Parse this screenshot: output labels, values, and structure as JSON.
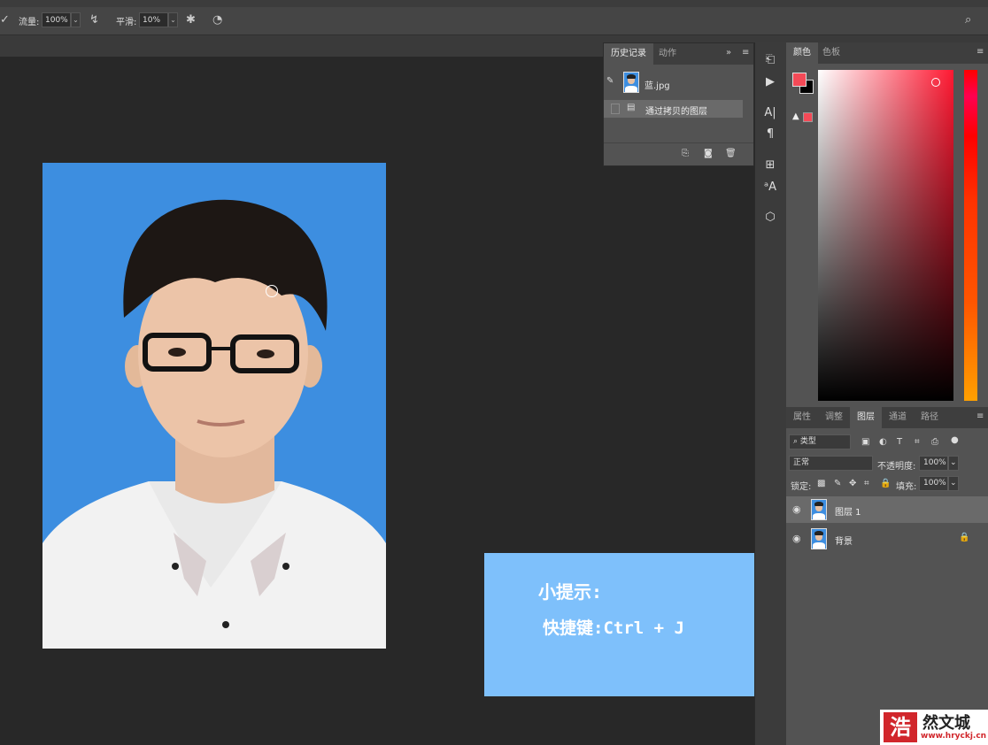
{
  "options_bar": {
    "flow_label": "流量:",
    "flow_value": "100%",
    "smooth_label": "平滑:",
    "smooth_value": "10%"
  },
  "history_panel": {
    "tabs": [
      "历史记录",
      "动作"
    ],
    "snapshot_name": "蓝.jpg",
    "steps": [
      "通过拷贝的图层"
    ]
  },
  "color_panel": {
    "tabs": [
      "颜色",
      "色板"
    ],
    "foreground": "#f44a57",
    "background": "#000000"
  },
  "layers_panel": {
    "tabs": [
      "属性",
      "调整",
      "图层",
      "通道",
      "路径"
    ],
    "filter_kind": "类型",
    "blend_mode": "正常",
    "opacity_label": "不透明度:",
    "opacity_value": "100%",
    "lock_label": "锁定:",
    "fill_label": "填充:",
    "fill_value": "100%",
    "layers": [
      {
        "name": "图层 1",
        "selected": true
      },
      {
        "name": "背景",
        "locked": true
      }
    ]
  },
  "tip": {
    "title": "小提示:",
    "body": "快捷键:Ctrl + J"
  },
  "watermark": {
    "logo": "浩",
    "text": "然文城",
    "url": "www.hryckj.cn"
  }
}
